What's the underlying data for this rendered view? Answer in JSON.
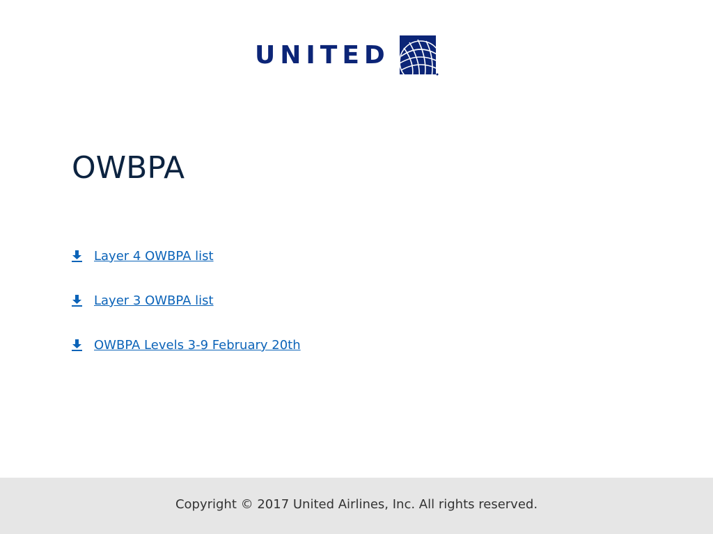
{
  "header": {
    "logo_text": "UNITED",
    "logo_icon": "globe-icon",
    "brand_color": "#0c2577"
  },
  "main": {
    "title": "OWBPA",
    "links": [
      {
        "label": "Layer 4 OWBPA list",
        "icon": "download-icon"
      },
      {
        "label": "Layer 3 OWBPA list",
        "icon": "download-icon"
      },
      {
        "label": "OWBPA Levels 3-9 February 20th",
        "icon": "download-icon"
      }
    ],
    "link_color": "#0b63b8"
  },
  "footer": {
    "copyright": "Copyright © 2017 United Airlines, Inc. All rights reserved."
  }
}
